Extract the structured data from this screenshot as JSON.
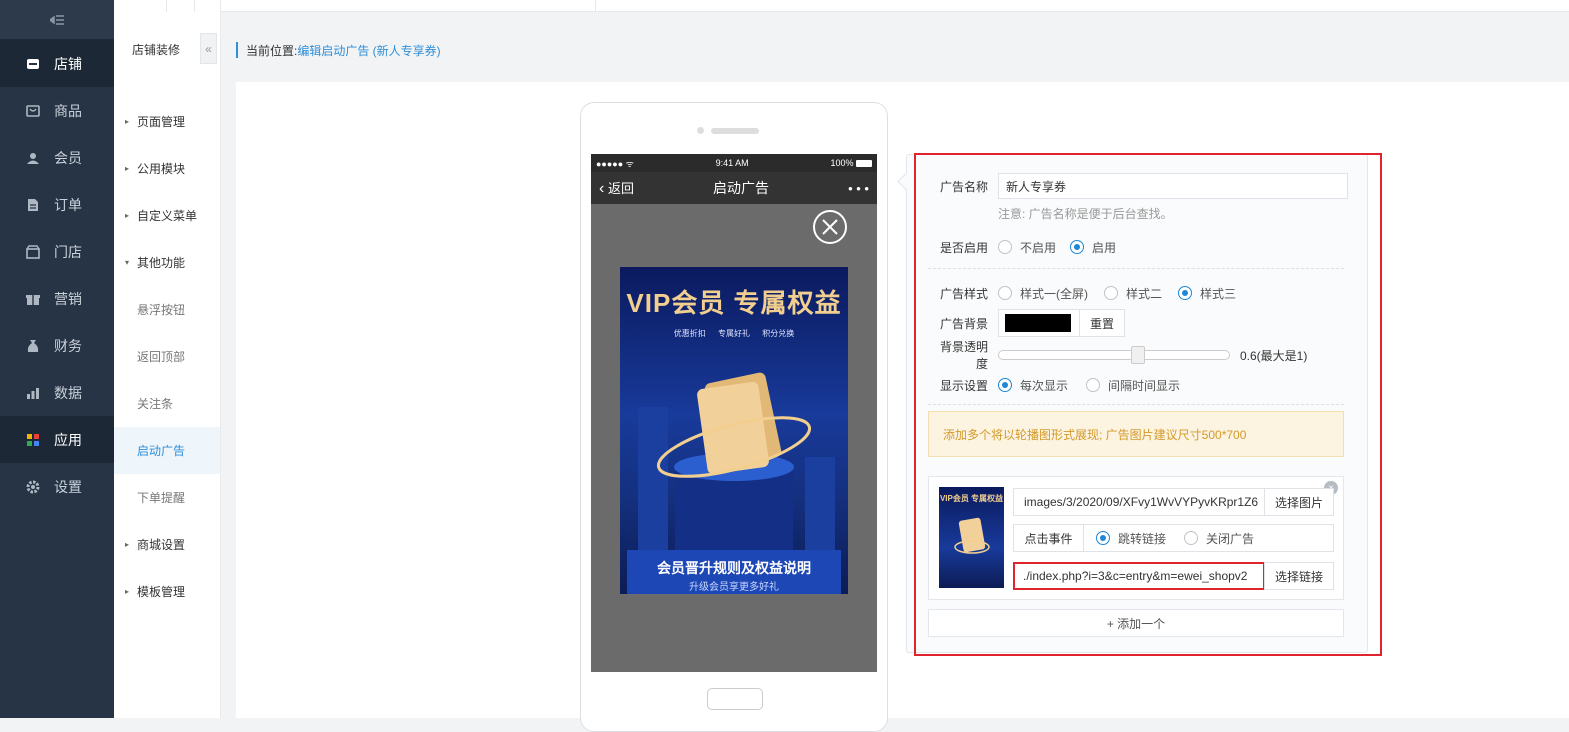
{
  "sidebar": {
    "toggle_icon": "collapse-icon",
    "items": [
      {
        "label": "店铺",
        "icon": "store-icon"
      },
      {
        "label": "商品",
        "icon": "goods-icon"
      },
      {
        "label": "会员",
        "icon": "member-icon"
      },
      {
        "label": "订单",
        "icon": "order-icon"
      },
      {
        "label": "门店",
        "icon": "shop-icon"
      },
      {
        "label": "营销",
        "icon": "gift-icon"
      },
      {
        "label": "财务",
        "icon": "money-bag-icon"
      },
      {
        "label": "数据",
        "icon": "chart-icon"
      },
      {
        "label": "应用",
        "icon": "apps-icon"
      },
      {
        "label": "设置",
        "icon": "gear-icon"
      }
    ],
    "active": "应用"
  },
  "subnav": {
    "title": "店铺装修",
    "collapse": "«",
    "items": [
      {
        "label": "页面管理"
      },
      {
        "label": "公用模块"
      },
      {
        "label": "自定义菜单"
      },
      {
        "label": "其他功能"
      },
      {
        "label": "悬浮按钮"
      },
      {
        "label": "返回顶部"
      },
      {
        "label": "关注条"
      },
      {
        "label": "启动广告"
      },
      {
        "label": "下单提醒"
      },
      {
        "label": "商城设置"
      },
      {
        "label": "模板管理"
      }
    ]
  },
  "breadcrumb": {
    "prefix": "当前位置:",
    "current": "编辑启动广告 (新人专享券)"
  },
  "phone": {
    "status_left": "●●●●● ᯤ",
    "status_time": "9:41 AM",
    "status_right": "100%",
    "back_label": "返回",
    "title": "启动广告",
    "more": "• • •",
    "poster": {
      "headline": "VIP会员 专属权益",
      "tags": "优惠折扣 专属好礼 积分兑换",
      "footer_title": "会员晋升规则及权益说明",
      "footer_sub": "升级会员享更多好礼"
    }
  },
  "form": {
    "name_label": "广告名称",
    "name_value": "新人专享券",
    "name_hint": "注意: 广告名称是便于后台查找。",
    "enable_label": "是否启用",
    "enable_options": [
      "不启用",
      "启用"
    ],
    "enable_selected": 1,
    "style_label": "广告样式",
    "style_options": [
      "样式一(全屏)",
      "样式二",
      "样式三"
    ],
    "style_selected": 2,
    "bg_label": "广告背景",
    "bg_color": "#000000",
    "bg_reset": "重置",
    "opacity_label": "背景透明度",
    "opacity_value": 0.6,
    "opacity_text": "0.6(最大是1)",
    "display_label": "显示设置",
    "display_options": [
      "每次显示",
      "间隔时间显示"
    ],
    "display_selected": 0,
    "notice": "添加多个将以轮播图形式展现; 广告图片建议尺寸500*700",
    "item": {
      "image_path": "images/3/2020/09/XFvy1WvVYPyvKRpr1Z6",
      "choose_image": "选择图片",
      "event_label": "点击事件",
      "event_options": [
        "跳转链接",
        "关闭广告"
      ],
      "event_selected": 0,
      "link_value": "./index.php?i=3&c=entry&m=ewei_shopv2",
      "choose_link": "选择链接",
      "delete": "×"
    },
    "add_label": "+ 添加一个"
  },
  "colors": {
    "sidebar_bg": "#263445",
    "accent": "#2f8fd8",
    "highlight_box": "#e0242e",
    "notice_text": "#d39a2a"
  }
}
